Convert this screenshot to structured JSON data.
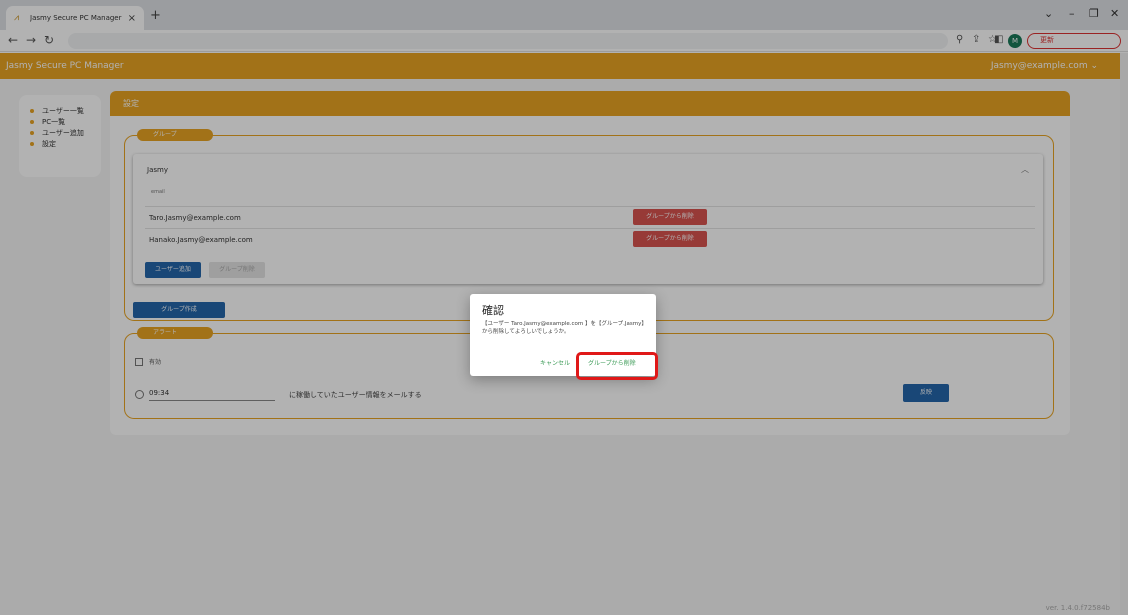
{
  "browser": {
    "tab_title": "Jasmy Secure PC Manager",
    "tab_close": "×",
    "new_tab": "+",
    "update_label": "更新",
    "avatar_letter": "M"
  },
  "app": {
    "brand": "Jasmy Secure PC Manager",
    "user_menu": "Jasmy@example.com ⌄",
    "version": "ver. 1.4.0.f72584b"
  },
  "sidebar": {
    "items": [
      {
        "label": "ユーザー一覧"
      },
      {
        "label": "PC一覧"
      },
      {
        "label": "ユーザー追加"
      },
      {
        "label": "設定"
      }
    ]
  },
  "settings": {
    "title": "設定",
    "group_section": {
      "legend": "グループ",
      "group_name": "Jasmy",
      "column_header": "email",
      "members": [
        {
          "email": "Taro.Jasmy@example.com",
          "remove_label": "グループから削除"
        },
        {
          "email": "Hanako.Jasmy@example.com",
          "remove_label": "グループから削除"
        }
      ],
      "add_user_label": "ユーザー追加",
      "delete_group_label": "グループ削除",
      "create_group_label": "グループ作成"
    },
    "alert_section": {
      "legend": "アラート",
      "enable_label": "有効",
      "time_value": "09:34",
      "description": "に稼働していたユーザー情報をメールする",
      "apply_label": "反映"
    }
  },
  "dialog": {
    "title": "確認",
    "message": "【ユーザー Taro.Jasmy@example.com 】を【グループ.Jasmy】から削除してよろしいでしょうか。",
    "cancel_label": "キャンセル",
    "confirm_label": "グループから削除"
  },
  "colors": {
    "accent": "#e9a423",
    "primary_button": "#2466ab",
    "danger_button": "#d9534f",
    "highlight": "#e01818"
  }
}
